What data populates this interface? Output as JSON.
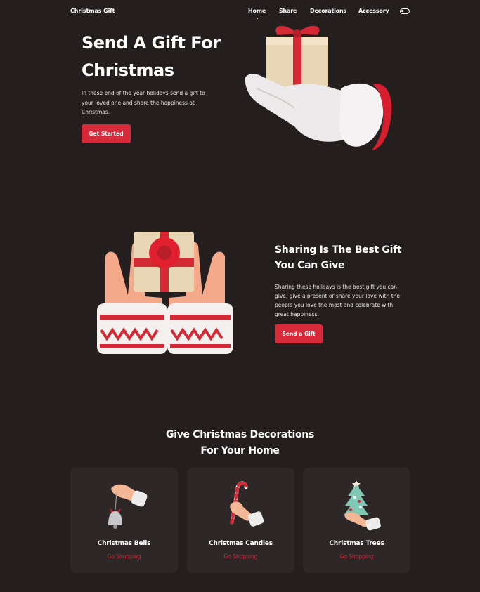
{
  "nav": {
    "brand": "Christmas Gift",
    "links": [
      {
        "label": "Home",
        "active": true
      },
      {
        "label": "Share",
        "active": false
      },
      {
        "label": "Decorations",
        "active": false
      },
      {
        "label": "Accessory",
        "active": false
      }
    ],
    "toggle_icon": "theme-toggle-icon"
  },
  "hero": {
    "title_line1": "Send A Gift For",
    "title_line2": "Christmas",
    "description": "In these end of the year holidays send a gift to your loved one and share the happiness at Christmas.",
    "button": "Get Started",
    "illustration": "glove-holding-gift"
  },
  "share": {
    "title_line1": "Sharing Is The Best Gift",
    "title_line2": "You Can Give",
    "description": "Sharing these holidays is the best gift you can give, give a present or share your love with the people you love the most and celebrate with great happiness.",
    "button": "Send a Gift",
    "illustration": "hands-holding-gift"
  },
  "decorations": {
    "title_line1": "Give Christmas Decorations",
    "title_line2": "For Your Home",
    "cards": [
      {
        "title": "Christmas Bells",
        "link": "Go Shopping",
        "icon": "bell-icon"
      },
      {
        "title": "Christmas Candies",
        "link": "Go Shopping",
        "icon": "candy-cane-icon"
      },
      {
        "title": "Christmas Trees",
        "link": "Go Shopping",
        "icon": "christmas-tree-icon"
      }
    ]
  },
  "colors": {
    "background": "#241e1e",
    "card": "#2d2727",
    "accent": "#d62a3b"
  }
}
